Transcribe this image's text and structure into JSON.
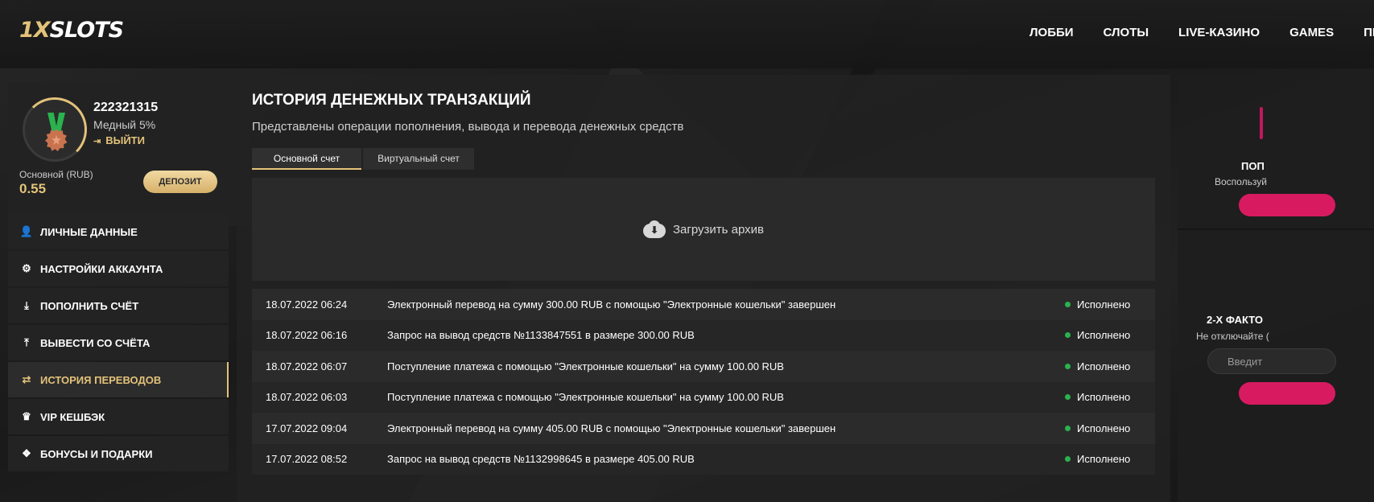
{
  "header": {
    "logo_prefix": "1X",
    "logo_suffix": "SLOTS",
    "nav": [
      "ЛОББИ",
      "СЛОТЫ",
      "LIVE-КАЗИНО",
      "GAMES",
      "ПР"
    ]
  },
  "profile": {
    "user_id": "222321315",
    "level": "Медный 5%",
    "logout_label": "ВЫЙТИ",
    "balance_label": "Основной (RUB)",
    "balance_value": "0.55",
    "deposit_label": "ДЕПОЗИТ"
  },
  "menu": [
    {
      "label": "ЛИЧНЫЕ ДАННЫЕ",
      "icon": "user-plus-icon",
      "active": false
    },
    {
      "label": "НАСТРОЙКИ АККАУНТА",
      "icon": "gears-icon",
      "active": false
    },
    {
      "label": "ПОПОЛНИТЬ СЧЁТ",
      "icon": "download-icon",
      "active": false
    },
    {
      "label": "ВЫВЕСТИ СО СЧЁТА",
      "icon": "upload-icon",
      "active": false
    },
    {
      "label": "ИСТОРИЯ ПЕРЕВОДОВ",
      "icon": "exchange-icon",
      "active": true
    },
    {
      "label": "VIP КЕШБЭК",
      "icon": "crown-icon",
      "active": false
    },
    {
      "label": "БОНУСЫ И ПОДАРКИ",
      "icon": "gift-icon",
      "active": false
    }
  ],
  "main": {
    "title": "ИСТОРИЯ ДЕНЕЖНЫХ ТРАНЗАКЦИЙ",
    "subtitle": "Представлены операции пополнения, вывода и перевода денежных средств",
    "tabs": [
      {
        "label": "Основной счет",
        "active": true
      },
      {
        "label": "Виртуальный счет",
        "active": false
      }
    ],
    "archive_label": "Загрузить архив",
    "transactions": [
      {
        "date": "18.07.2022 06:24",
        "description": "Электронный перевод на сумму 300.00 RUB с помощью \"Электронные кошельки\" завершен",
        "status": "Исполнено"
      },
      {
        "date": "18.07.2022 06:16",
        "description": "Запрос на вывод средств №1133847551 в размере 300.00 RUB",
        "status": "Исполнено"
      },
      {
        "date": "18.07.2022 06:07",
        "description": "Поступление платежа с помощью \"Электронные кошельки\" на сумму 100.00 RUB",
        "status": "Исполнено"
      },
      {
        "date": "18.07.2022 06:03",
        "description": "Поступление платежа с помощью \"Электронные кошельки\" на сумму 100.00 RUB",
        "status": "Исполнено"
      },
      {
        "date": "17.07.2022 09:04",
        "description": "Электронный перевод на сумму 405.00 RUB с помощью \"Электронные кошельки\" завершен",
        "status": "Исполнено"
      },
      {
        "date": "17.07.2022 08:52",
        "description": "Запрос на вывод средств №1132998645 в размере 405.00 RUB",
        "status": "Исполнено"
      }
    ]
  },
  "right_panel": {
    "title1": "ПОП",
    "text1": "Воспользуй",
    "title2": "2-Х ФАКТО",
    "text2": "Не отключайте (",
    "input_placeholder": "Введит"
  },
  "colors": {
    "accent_gold": "#e3c27a",
    "status_green": "#2ab24e",
    "accent_pink": "#d81b60"
  }
}
